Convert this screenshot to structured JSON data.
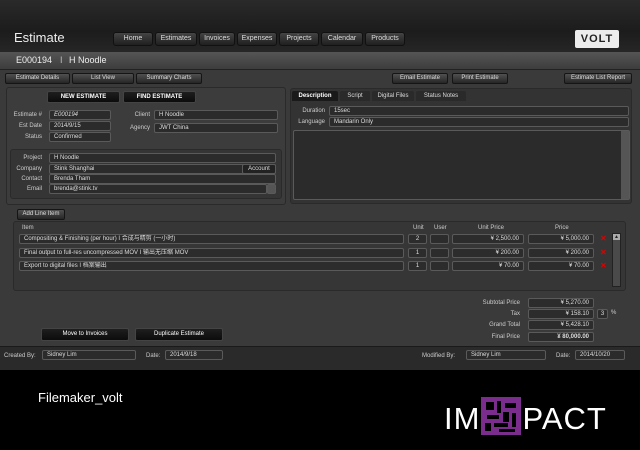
{
  "window": {
    "title": "Estimate"
  },
  "nav": [
    "Home",
    "Estimates",
    "Invoices",
    "Expenses",
    "Projects",
    "Calendar",
    "Products"
  ],
  "brand": {
    "logo_text": "VOLT",
    "accent": "#c0003b"
  },
  "header": {
    "estimate_id": "E000194",
    "separator": "I",
    "client_name": "H Noodle"
  },
  "toolbar": {
    "estimate_details": "Estimate Details",
    "list_view": "List View",
    "summary_charts": "Summary Charts",
    "email_estimate": "Email Estimate",
    "print_estimate": "Print Estimate",
    "estimate_list_report": "Estimate List Report"
  },
  "actions": {
    "new_estimate": "NEW ESTIMATE",
    "find_estimate": "FIND ESTIMATE"
  },
  "estimate": {
    "labels": {
      "estimate_no": "Estimate #",
      "est_date": "Est Date",
      "status": "Status",
      "client": "Client",
      "agency": "Agency"
    },
    "estimate_no": "E000194",
    "est_date": "2014/9/15",
    "status": "Confirmed",
    "client": "H Noodle",
    "agency": "JWT China"
  },
  "contact": {
    "labels": {
      "project": "Project",
      "company": "Company",
      "contact": "Contact",
      "email": "Email"
    },
    "project": "H Noodle",
    "company": "Stink Shanghai",
    "account_button": "Account",
    "contact": "Brenda Tham",
    "email": "brenda@stink.tv"
  },
  "tabs": [
    "Description",
    "Script",
    "Digital Files",
    "Status Notes"
  ],
  "description": {
    "labels": {
      "duration": "Duration",
      "language": "Language"
    },
    "duration": "15sec",
    "language": "Mandarin Only"
  },
  "line_items": {
    "add_button": "Add Line Item",
    "headers": {
      "item": "Item",
      "unit": "Unit",
      "user": "User",
      "unit_price": "Unit Price",
      "price": "Price"
    },
    "rows": [
      {
        "item": "Compositing & Finishing (per hour)  I  合成与精剪 (一小时)",
        "unit": "2",
        "user": "",
        "unit_price": "¥ 2,500.00",
        "price": "¥ 5,000.00"
      },
      {
        "item": "Final output to full-res uncompressed MOV  I  输出无压缩 MOV",
        "unit": "1",
        "user": "",
        "unit_price": "¥ 200.00",
        "price": "¥ 200.00"
      },
      {
        "item": "Export to digital files  I  档案输出",
        "unit": "1",
        "user": "",
        "unit_price": "¥ 70.00",
        "price": "¥ 70.00"
      }
    ]
  },
  "totals": {
    "labels": {
      "subtotal": "Subtotal Price",
      "tax": "Tax",
      "grand_total": "Grand Total",
      "final": "Final Price"
    },
    "subtotal": "¥ 5,270.00",
    "tax": "¥ 158.10",
    "tax_rate": "3",
    "tax_unit": "%",
    "grand_total": "¥ 5,428.10",
    "final": "¥ 80,000.00"
  },
  "bottom_actions": {
    "move_to_invoices": "Move to Invoices",
    "duplicate_estimate": "Duplicate Estimate"
  },
  "footer": {
    "created_by_label": "Created By:",
    "created_by": "Sidney Lim",
    "date_label": "Date:",
    "created_date": "2014/9/18",
    "modified_by_label": "Modified By:",
    "modified_by": "Sidney Lim",
    "modified_date_label": "Date:",
    "modified_date": "2014/10/20"
  },
  "caption": "Filemaker_volt",
  "impact": {
    "left": "IM",
    "right": "PACT",
    "mark_color": "#7a2d8c"
  }
}
